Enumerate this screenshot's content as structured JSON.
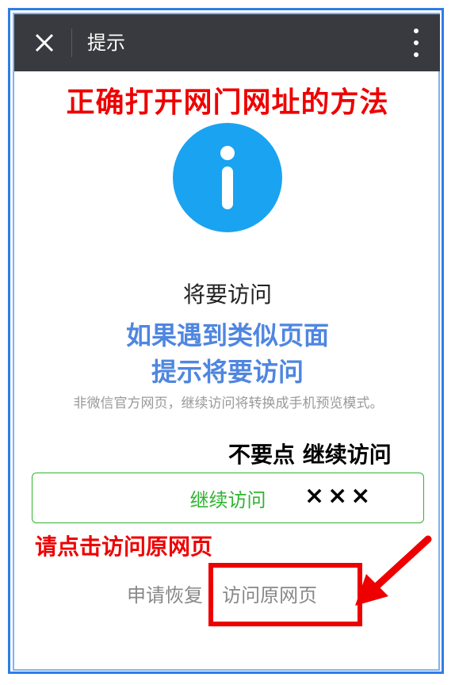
{
  "topbar": {
    "title": "提示",
    "close_icon": "close-icon",
    "more_icon": "more-vertical-icon"
  },
  "annotations": {
    "heading": "正确打开网门网址的方法",
    "blue_line1": "如果遇到类似页面",
    "blue_line2": "提示将要访问",
    "dont_click": "不要点 继续访问",
    "crosses": "×××",
    "please_click": "请点击访问原网页"
  },
  "notice": {
    "icon": "info-icon",
    "title": "将要访问",
    "description": "非微信官方网页，继续访问将转换成手机预览模式。"
  },
  "actions": {
    "continue_label": "继续访问",
    "restore_label": "申请恢复",
    "separator": "|",
    "visit_original_label": "访问原网页"
  },
  "colors": {
    "topbar_bg": "#393a3f",
    "info_blue": "#1aa3f0",
    "accent_green": "#2fb52f",
    "annotation_red": "#ee0000",
    "annotation_blue": "#4f86e0"
  }
}
